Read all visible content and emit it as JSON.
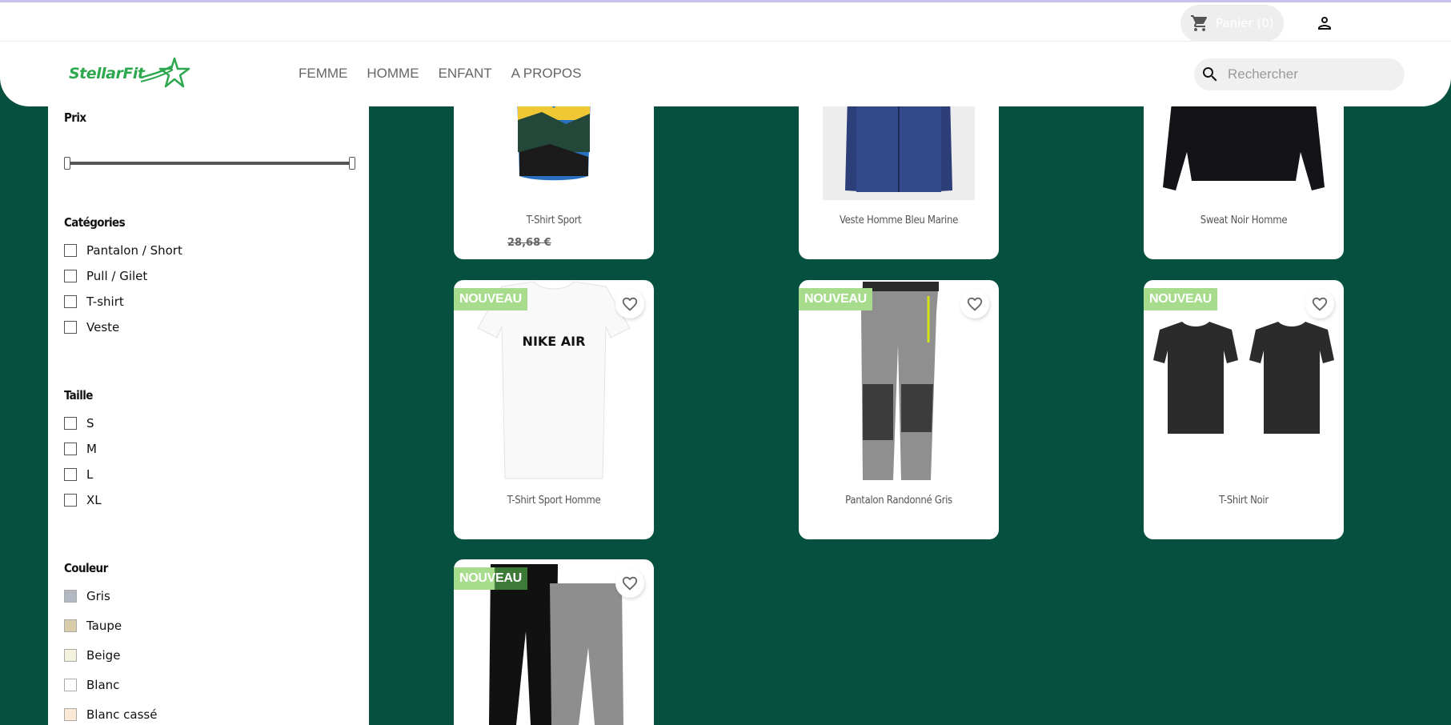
{
  "header": {
    "cart_label": "Panier (0)",
    "brand": "StellarFit",
    "nav": [
      "FEMME",
      "HOMME",
      "ENFANT",
      "A PROPOS"
    ],
    "search_placeholder": "Rechercher"
  },
  "filters": {
    "price": {
      "title": "Prix"
    },
    "categories": {
      "title": "Catégories",
      "items": [
        "Pantalon / Short",
        "Pull / Gilet",
        "T-shirt",
        "Veste"
      ]
    },
    "sizes": {
      "title": "Taille",
      "items": [
        "S",
        "M",
        "L",
        "XL"
      ]
    },
    "colors": {
      "title": "Couleur",
      "items": [
        {
          "label": "Gris",
          "hex": "#b2b8c2"
        },
        {
          "label": "Taupe",
          "hex": "#d8cbaa"
        },
        {
          "label": "Beige",
          "hex": "#f4f1dc"
        },
        {
          "label": "Blanc",
          "hex": "#ffffff"
        },
        {
          "label": "Blanc cassé",
          "hex": "#fbe9d6"
        }
      ]
    }
  },
  "products": [
    {
      "name": "T-Shirt Sport",
      "price": "28,68 €",
      "badge": ""
    },
    {
      "name": "Veste Homme Bleu Marine",
      "price": "",
      "badge": ""
    },
    {
      "name": "Sweat Noir Homme",
      "price": "",
      "badge": ""
    },
    {
      "name": "T-Shirt Sport Homme",
      "price": "",
      "badge": "NOUVEAU"
    },
    {
      "name": "Pantalon Randonné Gris",
      "price": "",
      "badge": "NOUVEAU"
    },
    {
      "name": "T-Shirt Noir",
      "price": "",
      "badge": "NOUVEAU"
    },
    {
      "name": "",
      "price": "",
      "badge": "NOUVEAU"
    }
  ],
  "product_images": {
    "tshirt_print": "NIKE AIR"
  },
  "colors": {
    "background": "#06503f",
    "brand_green": "#2ea84f",
    "badge": "#a7dc8d"
  }
}
